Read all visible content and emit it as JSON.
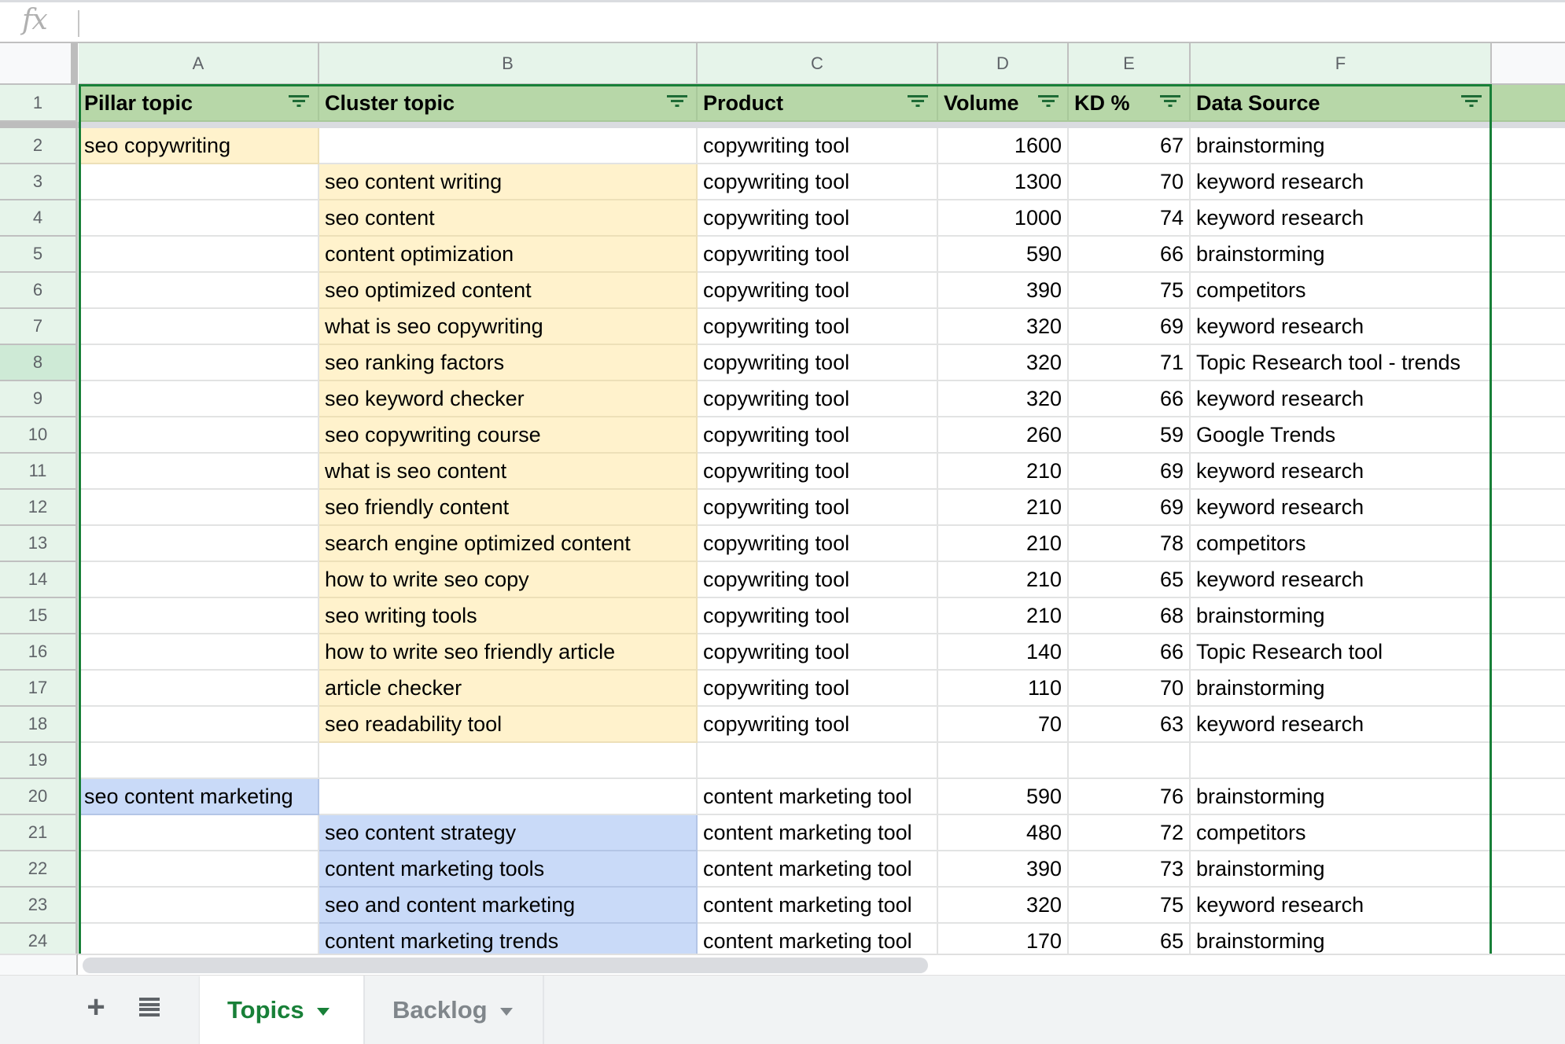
{
  "formula_bar": {
    "icon": "fx-icon",
    "value": ""
  },
  "columns": [
    "A",
    "B",
    "C",
    "D",
    "E",
    "F"
  ],
  "header_row": {
    "row_number": "1",
    "cells": [
      "Pillar topic",
      "Cluster topic",
      "Product",
      "Volume",
      "KD %",
      "Data Source"
    ],
    "filter_icon": "filter-icon"
  },
  "active_row": "8",
  "rows": [
    {
      "n": "2",
      "a": "seo copywriting",
      "b": "",
      "c": "copywriting tool",
      "d": "1600",
      "e": "67",
      "f": "brainstorming",
      "group": "yellow",
      "kind": "pillar"
    },
    {
      "n": "3",
      "a": "",
      "b": "seo content writing",
      "c": "copywriting tool",
      "d": "1300",
      "e": "70",
      "f": "keyword research",
      "group": "yellow",
      "kind": "cluster"
    },
    {
      "n": "4",
      "a": "",
      "b": "seo content",
      "c": "copywriting tool",
      "d": "1000",
      "e": "74",
      "f": "keyword research",
      "group": "yellow",
      "kind": "cluster"
    },
    {
      "n": "5",
      "a": "",
      "b": "content optimization",
      "c": "copywriting tool",
      "d": "590",
      "e": "66",
      "f": "brainstorming",
      "group": "yellow",
      "kind": "cluster"
    },
    {
      "n": "6",
      "a": "",
      "b": "seo optimized content",
      "c": "copywriting tool",
      "d": "390",
      "e": "75",
      "f": "competitors",
      "group": "yellow",
      "kind": "cluster"
    },
    {
      "n": "7",
      "a": "",
      "b": "what is seo copywriting",
      "c": "copywriting tool",
      "d": "320",
      "e": "69",
      "f": "keyword research",
      "group": "yellow",
      "kind": "cluster"
    },
    {
      "n": "8",
      "a": "",
      "b": "seo ranking factors",
      "c": "copywriting tool",
      "d": "320",
      "e": "71",
      "f": "Topic Research tool - trends",
      "group": "yellow",
      "kind": "cluster"
    },
    {
      "n": "9",
      "a": "",
      "b": "seo keyword checker",
      "c": "copywriting tool",
      "d": "320",
      "e": "66",
      "f": "keyword research",
      "group": "yellow",
      "kind": "cluster"
    },
    {
      "n": "10",
      "a": "",
      "b": "seo copywriting course",
      "c": "copywriting tool",
      "d": "260",
      "e": "59",
      "f": "Google Trends",
      "group": "yellow",
      "kind": "cluster"
    },
    {
      "n": "11",
      "a": "",
      "b": "what is seo content",
      "c": "copywriting tool",
      "d": "210",
      "e": "69",
      "f": "keyword research",
      "group": "yellow",
      "kind": "cluster"
    },
    {
      "n": "12",
      "a": "",
      "b": "seo friendly content",
      "c": "copywriting tool",
      "d": "210",
      "e": "69",
      "f": "keyword research",
      "group": "yellow",
      "kind": "cluster"
    },
    {
      "n": "13",
      "a": "",
      "b": "search engine optimized content",
      "c": "copywriting tool",
      "d": "210",
      "e": "78",
      "f": "competitors",
      "group": "yellow",
      "kind": "cluster"
    },
    {
      "n": "14",
      "a": "",
      "b": "how to write seo copy",
      "c": "copywriting tool",
      "d": "210",
      "e": "65",
      "f": "keyword research",
      "group": "yellow",
      "kind": "cluster"
    },
    {
      "n": "15",
      "a": "",
      "b": "seo writing tools",
      "c": "copywriting tool",
      "d": "210",
      "e": "68",
      "f": "brainstorming",
      "group": "yellow",
      "kind": "cluster"
    },
    {
      "n": "16",
      "a": "",
      "b": "how to write seo friendly article",
      "c": "copywriting tool",
      "d": "140",
      "e": "66",
      "f": "Topic Research tool",
      "group": "yellow",
      "kind": "cluster"
    },
    {
      "n": "17",
      "a": "",
      "b": "article checker",
      "c": "copywriting tool",
      "d": "110",
      "e": "70",
      "f": "brainstorming",
      "group": "yellow",
      "kind": "cluster"
    },
    {
      "n": "18",
      "a": "",
      "b": "seo readability tool",
      "c": "copywriting tool",
      "d": "70",
      "e": "63",
      "f": "keyword research",
      "group": "yellow",
      "kind": "cluster"
    },
    {
      "n": "19",
      "a": "",
      "b": "",
      "c": "",
      "d": "",
      "e": "",
      "f": "",
      "group": "none",
      "kind": "empty"
    },
    {
      "n": "20",
      "a": "seo content marketing",
      "b": "",
      "c": "content marketing tool",
      "d": "590",
      "e": "76",
      "f": "brainstorming",
      "group": "blue",
      "kind": "pillar"
    },
    {
      "n": "21",
      "a": "",
      "b": "seo content strategy",
      "c": "content marketing tool",
      "d": "480",
      "e": "72",
      "f": "competitors",
      "group": "blue",
      "kind": "cluster"
    },
    {
      "n": "22",
      "a": "",
      "b": "content marketing tools",
      "c": "content marketing tool",
      "d": "390",
      "e": "73",
      "f": "brainstorming",
      "group": "blue",
      "kind": "cluster"
    },
    {
      "n": "23",
      "a": "",
      "b": "seo and content marketing",
      "c": "content marketing tool",
      "d": "320",
      "e": "75",
      "f": "keyword research",
      "group": "blue",
      "kind": "cluster"
    },
    {
      "n": "24",
      "a": "",
      "b": "content marketing trends",
      "c": "content marketing tool",
      "d": "170",
      "e": "65",
      "f": "brainstorming",
      "group": "blue",
      "kind": "cluster"
    }
  ],
  "colors": {
    "header_fill": "#b7d7a8",
    "pillar_1_fill": "#fff2cc",
    "pillar_2_fill": "#c9daf8",
    "filter_border": "#188038",
    "active_tab": "#188038"
  },
  "sheet_tabs": {
    "add_icon": "plus-icon",
    "list_icon": "sheet-list-icon",
    "tabs": [
      {
        "label": "Topics",
        "active": true
      },
      {
        "label": "Backlog",
        "active": false
      }
    ]
  }
}
